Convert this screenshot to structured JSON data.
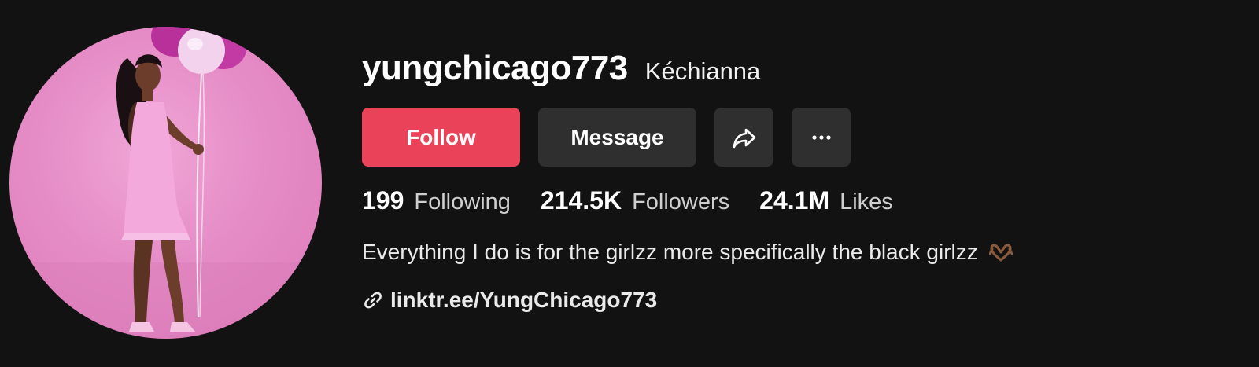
{
  "profile": {
    "username": "yungchicago773",
    "nickname": "Kéchianna",
    "avatar_icon": "profile-photo"
  },
  "actions": {
    "follow_label": "Follow",
    "message_label": "Message",
    "share_icon": "share-icon",
    "more_icon": "more-icon"
  },
  "stats": {
    "following": {
      "value": "199",
      "label": "Following"
    },
    "followers": {
      "value": "214.5K",
      "label": "Followers"
    },
    "likes": {
      "value": "24.1M",
      "label": "Likes"
    }
  },
  "bio": {
    "text": "Everything I do is for the girlzz more specifically the black girlzz",
    "emoji_icon": "heart-hands-icon"
  },
  "link": {
    "text": "linktr.ee/YungChicago773",
    "icon": "link-icon"
  },
  "colors": {
    "background": "#121212",
    "follow_accent": "#ea4359",
    "secondary_button": "#2f2f2f",
    "avatar_pink": "#e58cc6"
  }
}
